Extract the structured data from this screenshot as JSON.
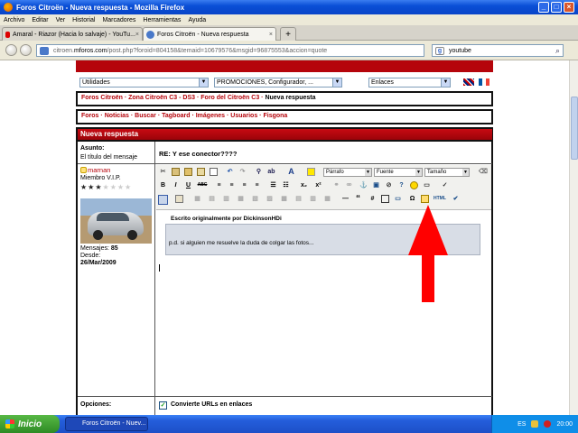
{
  "window": {
    "title": "Foros Citroën - Nueva respuesta - Mozilla Firefox"
  },
  "menu": [
    "Archivo",
    "Editar",
    "Ver",
    "Historial",
    "Marcadores",
    "Herramientas",
    "Ayuda"
  ],
  "tabs": [
    {
      "label": "Amaral - Riazor (Hacia lo salvaje) - YouTu..."
    },
    {
      "label": "Foros Citroën - Nueva respuesta"
    }
  ],
  "new_tab": "+",
  "url": {
    "prefix": "citroen.",
    "host": "mforos.com",
    "path": "/post.php?foroid=804158&temaid=10679576&msgid=96875553&accion=quote"
  },
  "search": {
    "value": "youtube"
  },
  "selects": {
    "utilidades": "Utilidades",
    "promociones": "PROMOCIONES, Configurador, ...",
    "enlaces": "Enlaces"
  },
  "breadcrumb": {
    "parts": [
      "Foros Citroën",
      "Zona Citroën C3 - DS3",
      "Foro del Citroën C3"
    ],
    "current": "Nueva respuesta",
    "sep": " · "
  },
  "topnav": {
    "items": [
      "Foros",
      "Noticias",
      "Buscar",
      "Tagboard",
      "Imágenes",
      "Usuarios",
      "Fisgona"
    ],
    "sep": " · "
  },
  "panel": {
    "title": "Nueva respuesta",
    "asunto_label": "Asunto:",
    "asunto_hint": "El título del mensaje",
    "asunto_value": "RE: Y ese conector????",
    "opciones_label": "Opciones:",
    "opcion_urls": "Convierte URLs en enlaces"
  },
  "user": {
    "name": "marnan",
    "rank": "Miembro V.I.P.",
    "stars_filled": 3,
    "stars_total": 7,
    "mensajes_label": "Mensajes:",
    "mensajes": "85",
    "desde_label": "Desde:",
    "desde": "26/Mar/2009"
  },
  "editor": {
    "parrafo": "Párrafo",
    "fuente": "Fuente",
    "tamano": "Tamaño",
    "quote_author": "Escrito originalmente por DickinsonHDi",
    "quote_text": "p.d. si alguien me resuelve la duda de colgar las fotos...",
    "btn_bold": "B",
    "btn_italic": "I",
    "btn_underline": "U",
    "btn_strike": "ABC",
    "btn_sub": "x₂",
    "btn_sup": "x²",
    "btn_omega": "Ω",
    "btn_hash": "#",
    "btn_quote": "“",
    "btn_font": "A"
  },
  "taskbar": {
    "start": "Inicio",
    "task": "Foros Citroën - Nuev...",
    "lang": "ES",
    "time": "20:00"
  },
  "colors": {
    "brand_red": "#b5040b",
    "arrow_red": "#ff0000",
    "quote_bg": "#d8dde6"
  }
}
